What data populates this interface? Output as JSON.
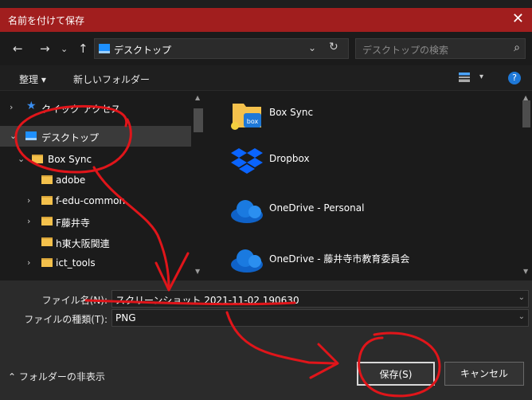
{
  "window": {
    "title": "名前を付けて保存",
    "close_glyph": "✕"
  },
  "address": {
    "location": "デスクトップ",
    "search_placeholder": "デスクトップの検索"
  },
  "toolbar": {
    "organize": "整理 ▾",
    "new_folder": "新しいフォルダー"
  },
  "tree": [
    {
      "label": "クイック アクセス",
      "icon": "star-icon"
    },
    {
      "label": "デスクトップ",
      "icon": "desktop-icon",
      "selected": true
    },
    {
      "label": "Box Sync",
      "icon": "folder-icon"
    },
    {
      "label": "adobe",
      "icon": "folder-icon"
    },
    {
      "label": "f-edu-common",
      "icon": "folder-icon"
    },
    {
      "label": "F藤井寺",
      "icon": "folder-icon"
    },
    {
      "label": "h東大阪関連",
      "icon": "folder-icon"
    },
    {
      "label": "ict_tools",
      "icon": "folder-icon"
    }
  ],
  "files": [
    {
      "label": "Box Sync",
      "icon": "box-folder-icon"
    },
    {
      "label": "Dropbox",
      "icon": "dropbox-icon"
    },
    {
      "label": "OneDrive - Personal",
      "icon": "onedrive-icon"
    },
    {
      "label": "OneDrive - 藤井寺市教育委員会",
      "icon": "onedrive-icon"
    }
  ],
  "form": {
    "filename_label": "ファイル名(N):",
    "filename_value": "スクリーンショット 2021-11-02 190630",
    "filetype_label": "ファイルの種類(T):",
    "filetype_value": "PNG"
  },
  "footer": {
    "hide_folders": "フォルダーの非表示",
    "save": "保存(S)",
    "cancel": "キャンセル"
  },
  "colors": {
    "title_bar": "#a11e1e",
    "annotation": "#e0151a",
    "accent": "#1e78d7"
  }
}
